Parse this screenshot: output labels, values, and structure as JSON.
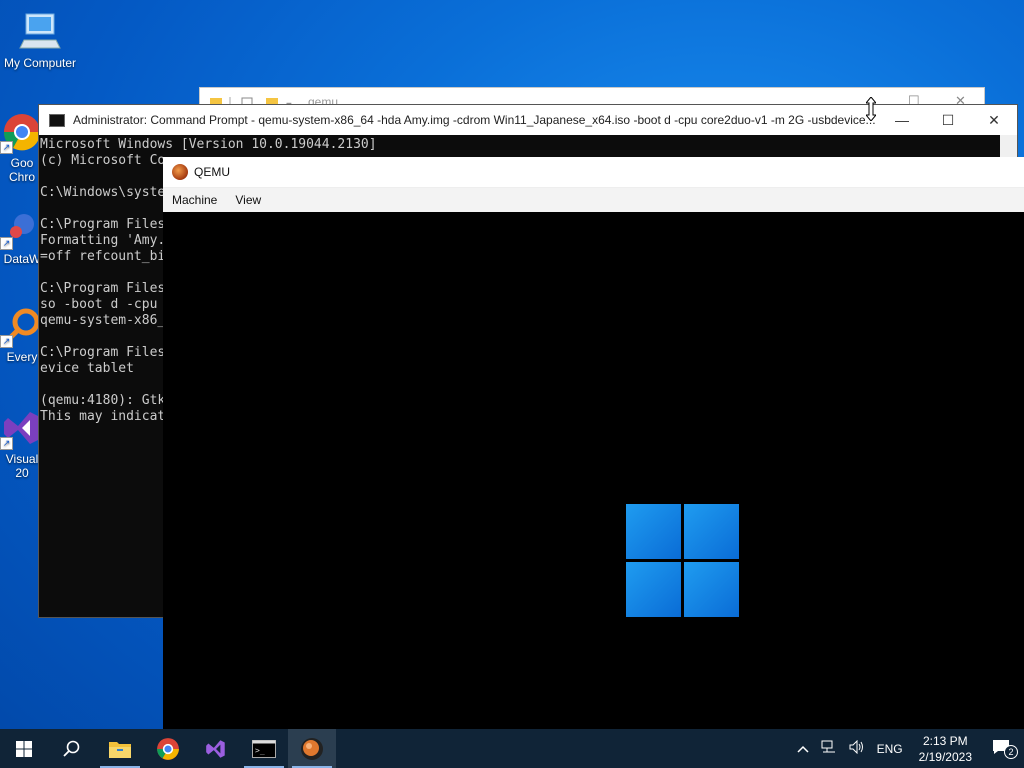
{
  "desktop": {
    "icons": [
      {
        "label": "My Computer"
      },
      {
        "label": "Goo\nChro"
      },
      {
        "label": "DataW"
      },
      {
        "label": "Every"
      },
      {
        "label": "Visual\n20"
      }
    ]
  },
  "explorer": {
    "title": "qemu"
  },
  "cmd": {
    "title": "Administrator: Command Prompt - qemu-system-x86_64  -hda Amy.img -cdrom Win11_Japanese_x64.iso -boot d -cpu core2duo-v1 -m 2G -usbdevice...",
    "lines": [
      "Microsoft Windows [Version 10.0.19044.2130]",
      "(c) Microsoft Co",
      "",
      "C:\\Windows\\syste",
      "",
      "C:\\Program Files",
      "Formatting 'Amy.",
      "=off refcount_bi",
      "",
      "C:\\Program Files",
      "so -boot d -cpu ",
      "qemu-system-x86_",
      "",
      "C:\\Program Files",
      "evice tablet",
      "",
      "(qemu:4180): Gtk",
      "This may indicat"
    ],
    "minimize": "—",
    "maximize": "☐",
    "close": "✕"
  },
  "qemu": {
    "title": "QEMU",
    "menu": [
      "Machine",
      "View"
    ]
  },
  "taskbar": {
    "items": [
      "start",
      "search",
      "file-explorer",
      "chrome",
      "visual-studio",
      "command-prompt",
      "qemu"
    ],
    "language": "ENG",
    "time": "2:13 PM",
    "date": "2/19/2023",
    "notification_count": "2"
  }
}
